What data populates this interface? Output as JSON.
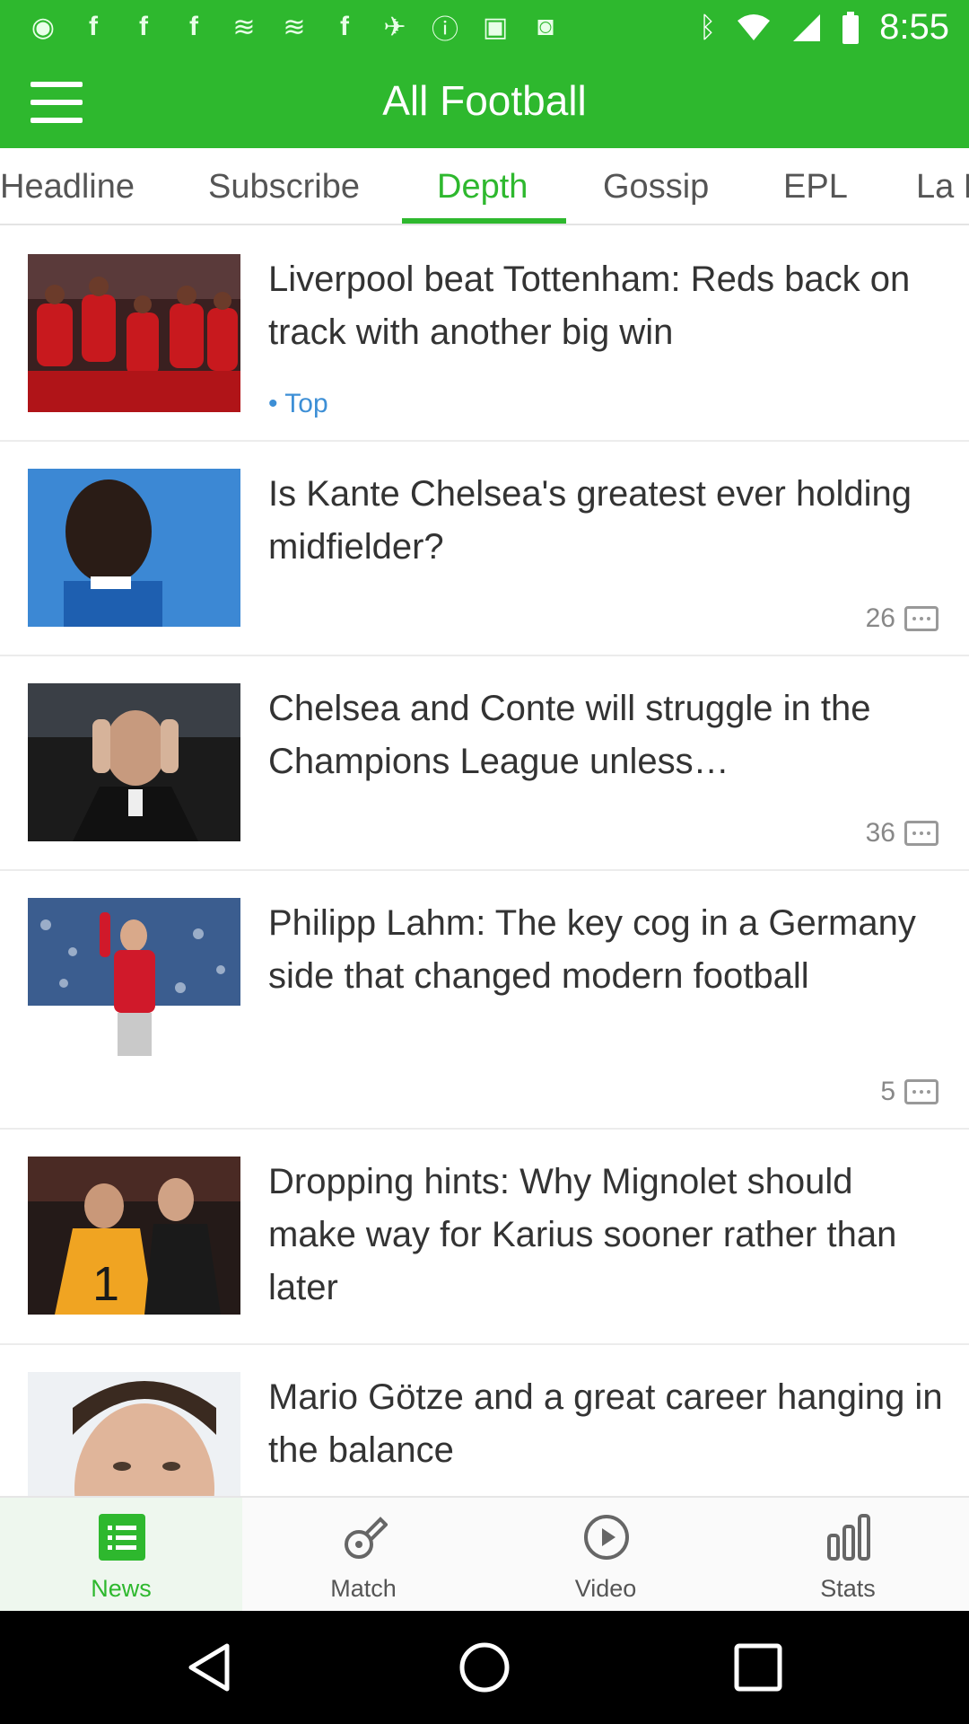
{
  "status_bar": {
    "time": "8:55",
    "left_icons": [
      "record-icon",
      "facebook-icon",
      "facebook-icon",
      "facebook-icon",
      "wind-icon",
      "wind-icon",
      "facebook-icon",
      "satellite-icon",
      "alert-icon",
      "lock-icon",
      "android-icon"
    ],
    "right_icons": [
      "bluetooth-icon",
      "wifi-icon",
      "signal-icon",
      "battery-icon"
    ]
  },
  "app_bar": {
    "title": "All Football"
  },
  "tabs": [
    "Headline",
    "Subscribe",
    "Depth",
    "Gossip",
    "EPL",
    "La Liga"
  ],
  "active_tab": "Depth",
  "articles": [
    {
      "headline": "Liverpool beat Tottenham: Reds back on track with another big win",
      "tag": "• Top"
    },
    {
      "headline": "Is Kante Chelsea's greatest ever holding midfielder?",
      "comments": "26"
    },
    {
      "headline": "Chelsea and Conte will struggle in the Champions League unless…",
      "comments": "36"
    },
    {
      "headline": "Philipp Lahm: The key cog in a Germany side that changed modern football",
      "comments": "5"
    },
    {
      "headline": "Dropping hints: Why Mignolet should make way for Karius sooner rather than later"
    },
    {
      "headline": "Mario Götze and a great career hanging in the balance"
    }
  ],
  "bottom_nav": {
    "items": [
      {
        "label": "News",
        "icon": "news-list-icon"
      },
      {
        "label": "Match",
        "icon": "whistle-icon"
      },
      {
        "label": "Video",
        "icon": "play-circle-icon"
      },
      {
        "label": "Stats",
        "icon": "bar-chart-icon"
      }
    ],
    "active": "News"
  },
  "colors": {
    "brand_green": "#2eb82e",
    "tag_blue": "#3d8fd6"
  }
}
